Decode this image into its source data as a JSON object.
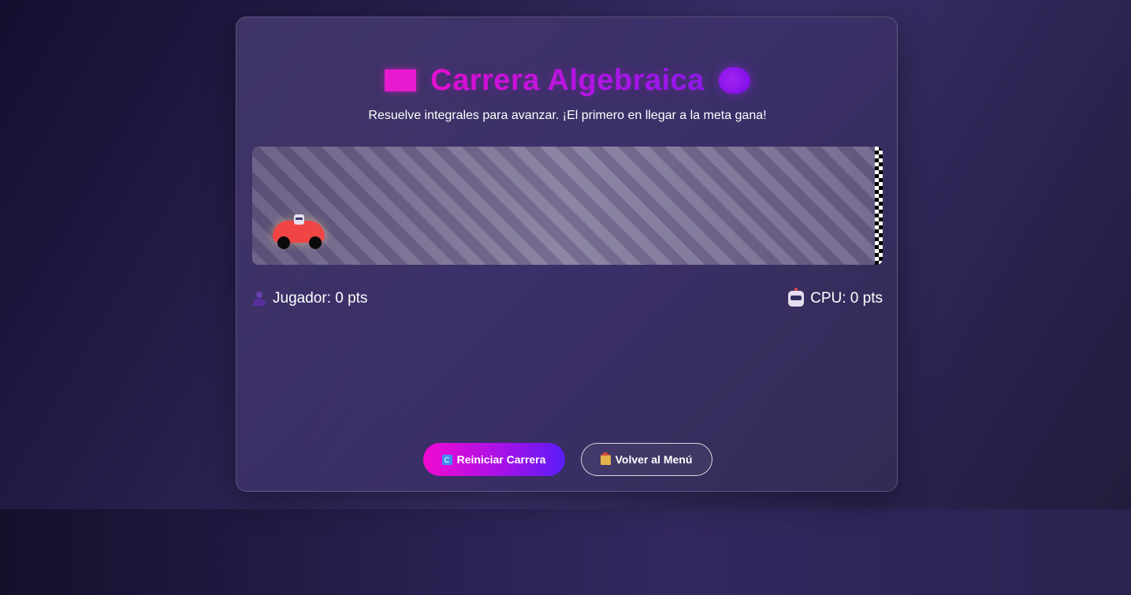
{
  "header": {
    "title": "Carrera Algebraica",
    "subtitle": "Resuelve integrales para avanzar. ¡El primero en llegar a la meta gana!",
    "title_left_icon": "checkered-flag-icon",
    "title_right_icon": "brain-icon"
  },
  "race": {
    "player_car_icon": "car-icon",
    "cpu_progress": 0,
    "finish_line_icon": "finish-line"
  },
  "scores": {
    "player_label": "Jugador: 0 pts",
    "player_icon": "person-icon",
    "cpu_label": "CPU: 0 pts",
    "cpu_icon": "robot-icon"
  },
  "actions": {
    "restart_label": "Reiniciar Carrera",
    "restart_icon": "refresh-icon",
    "menu_label": "Volver al Menú",
    "menu_icon": "house-icon"
  },
  "colors": {
    "accent_pink": "#e90fce",
    "accent_purple": "#8a19f0",
    "car_red": "#f04545"
  }
}
